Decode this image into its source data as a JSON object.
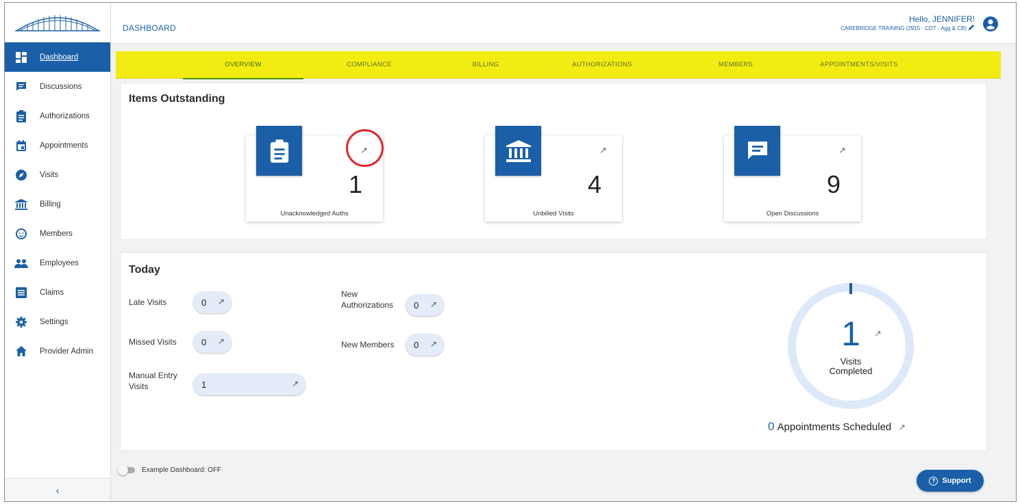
{
  "header": {
    "title": "DASHBOARD",
    "greeting": "Hello, JENNIFER!",
    "organization": "CAREBRIDGE TRAINING (2915 - CDT - Agg & CB)"
  },
  "sidebar": {
    "items": [
      {
        "label": "Dashboard",
        "icon": "dashboard-icon"
      },
      {
        "label": "Discussions",
        "icon": "chat-icon"
      },
      {
        "label": "Authorizations",
        "icon": "clipboard-icon"
      },
      {
        "label": "Appointments",
        "icon": "calendar-icon"
      },
      {
        "label": "Visits",
        "icon": "compass-icon"
      },
      {
        "label": "Billing",
        "icon": "bank-icon"
      },
      {
        "label": "Members",
        "icon": "face-icon"
      },
      {
        "label": "Employees",
        "icon": "people-icon"
      },
      {
        "label": "Claims",
        "icon": "list-icon"
      },
      {
        "label": "Settings",
        "icon": "gear-icon"
      },
      {
        "label": "Provider Admin",
        "icon": "home-icon"
      }
    ],
    "collapse": "‹"
  },
  "tabs": [
    "OVERVIEW",
    "COMPLIANCE",
    "BILLING",
    "AUTHORIZATIONS",
    "MEMBERS",
    "APPOINTMENTS/VISITS"
  ],
  "outstanding": {
    "title": "Items Outstanding",
    "cards": [
      {
        "value": "1",
        "label": "Unacknowledged Auths",
        "icon": "clipboard-icon"
      },
      {
        "value": "4",
        "label": "Unbilled Visits",
        "icon": "bank-icon"
      },
      {
        "value": "9",
        "label": "Open Discussions",
        "icon": "chat-icon"
      }
    ]
  },
  "today": {
    "title": "Today",
    "late_visits_label": "Late Visits",
    "late_visits": "0",
    "missed_visits_label": "Missed Visits",
    "missed_visits": "0",
    "manual_entry_label_1": "Manual Entry",
    "manual_entry_label_2": "Visits",
    "manual_entry": "1",
    "new_auths_label_1": "New",
    "new_auths_label_2": "Authorizations",
    "new_auths": "0",
    "new_members_label": "New Members",
    "new_members": "0",
    "visits_completed": "1",
    "visits_completed_label_1": "Visits",
    "visits_completed_label_2": "Completed",
    "appointments_scheduled": "0",
    "appointments_scheduled_label": "Appointments Scheduled"
  },
  "toggle": {
    "label": "Example Dashboard: OFF"
  },
  "support": {
    "label": "Support"
  },
  "arrow": "↗",
  "colors": {
    "primary": "#1a5fa8",
    "tab_bar": "#f3ec12",
    "highlight": "#e0222a"
  }
}
